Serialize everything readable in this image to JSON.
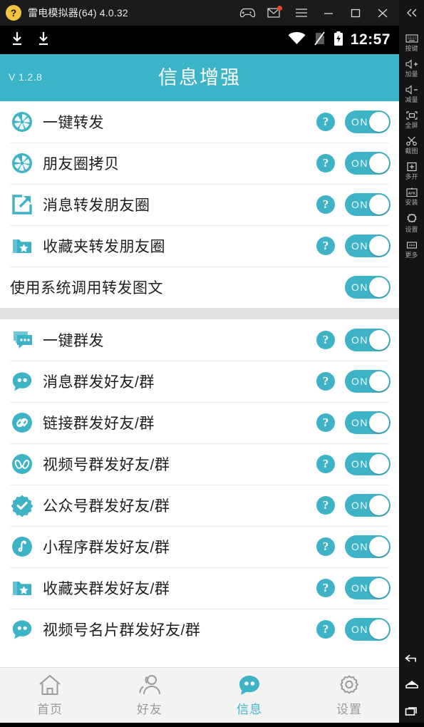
{
  "window": {
    "title": "雷电模拟器(64) 4.0.32",
    "logo_icon": "lightning-logo",
    "controls": [
      {
        "name": "gamepad-icon",
        "label": "gamepad"
      },
      {
        "name": "mail-icon",
        "label": "mail",
        "badge": true
      },
      {
        "name": "menu-icon",
        "label": "menu"
      },
      {
        "name": "minimize-icon",
        "label": "minimize"
      },
      {
        "name": "maximize-icon",
        "label": "maximize"
      },
      {
        "name": "close-icon",
        "label": "close"
      }
    ],
    "collapse_icon": "double-chevron-left-icon"
  },
  "statusbar": {
    "left_icons": [
      "download-icon",
      "download-icon"
    ],
    "right_icons": [
      "wifi-icon",
      "sim-off-icon",
      "battery-charging-icon"
    ],
    "clock": "12:57"
  },
  "header": {
    "version": "V 1.2.8",
    "title": "信息增强",
    "background": "#3ab4c6"
  },
  "theme": {
    "accent": "#3fb3c6",
    "toggle_on_bg": "#3fb3c6",
    "text": "#1e1e1e",
    "tab_inactive": "#9b9b9b"
  },
  "groups": [
    {
      "id": "forward-group",
      "items": [
        {
          "label": "一键转发",
          "icon": "aperture-icon",
          "help": true,
          "toggle": "ON"
        },
        {
          "label": "朋友圈拷贝",
          "icon": "aperture-icon",
          "help": true,
          "toggle": "ON"
        },
        {
          "label": "消息转发朋友圈",
          "icon": "share-box-icon",
          "help": true,
          "toggle": "ON"
        },
        {
          "label": "收藏夹转发朋友圈",
          "icon": "folder-star-icon",
          "help": true,
          "toggle": "ON"
        },
        {
          "label": "使用系统调用转发图文",
          "icon": null,
          "help": false,
          "toggle": "ON"
        }
      ]
    },
    {
      "id": "mass-send-group",
      "items": [
        {
          "label": "一键群发",
          "icon": "chat-stack-icon",
          "help": true,
          "toggle": "ON"
        },
        {
          "label": "消息群发好友/群",
          "icon": "chat-bubble-icon",
          "help": true,
          "toggle": "ON"
        },
        {
          "label": "链接群发好友/群",
          "icon": "link-icon",
          "help": true,
          "toggle": "ON"
        },
        {
          "label": "视频号群发好友/群",
          "icon": "channels-icon",
          "help": true,
          "toggle": "ON"
        },
        {
          "label": "公众号群发好友/群",
          "icon": "verified-badge-icon",
          "help": true,
          "toggle": "ON"
        },
        {
          "label": "小程序群发好友/群",
          "icon": "miniprogram-icon",
          "help": true,
          "toggle": "ON"
        },
        {
          "label": "收藏夹群发好友/群",
          "icon": "folder-star-icon",
          "help": true,
          "toggle": "ON"
        },
        {
          "label": "视频号名片群发好友/群",
          "icon": "chat-bubble-icon",
          "help": true,
          "toggle": "ON"
        }
      ]
    }
  ],
  "help_glyph": "?",
  "tabs": [
    {
      "label": "首页",
      "icon": "home-icon",
      "active": false
    },
    {
      "label": "好友",
      "icon": "friends-icon",
      "active": false
    },
    {
      "label": "信息",
      "icon": "message-icon",
      "active": true
    },
    {
      "label": "设置",
      "icon": "gear-icon",
      "active": false
    }
  ],
  "sidebar": {
    "items": [
      {
        "label": "按键",
        "icon": "keyboard-icon"
      },
      {
        "label": "加量",
        "icon": "volume-up-icon"
      },
      {
        "label": "减量",
        "icon": "volume-down-icon"
      },
      {
        "label": "全屏",
        "icon": "fullscreen-icon"
      },
      {
        "label": "截图",
        "icon": "scissors-icon"
      },
      {
        "label": "多开",
        "icon": "multi-instance-icon"
      },
      {
        "label": "安装",
        "icon": "apk-install-icon"
      },
      {
        "label": "设置",
        "icon": "gear-icon"
      },
      {
        "label": "更多",
        "icon": "ellipsis-icon"
      }
    ],
    "nav": [
      {
        "icon": "back-icon",
        "label": "back"
      },
      {
        "icon": "home-nav-icon",
        "label": "home"
      },
      {
        "icon": "recents-icon",
        "label": "recents"
      }
    ]
  }
}
